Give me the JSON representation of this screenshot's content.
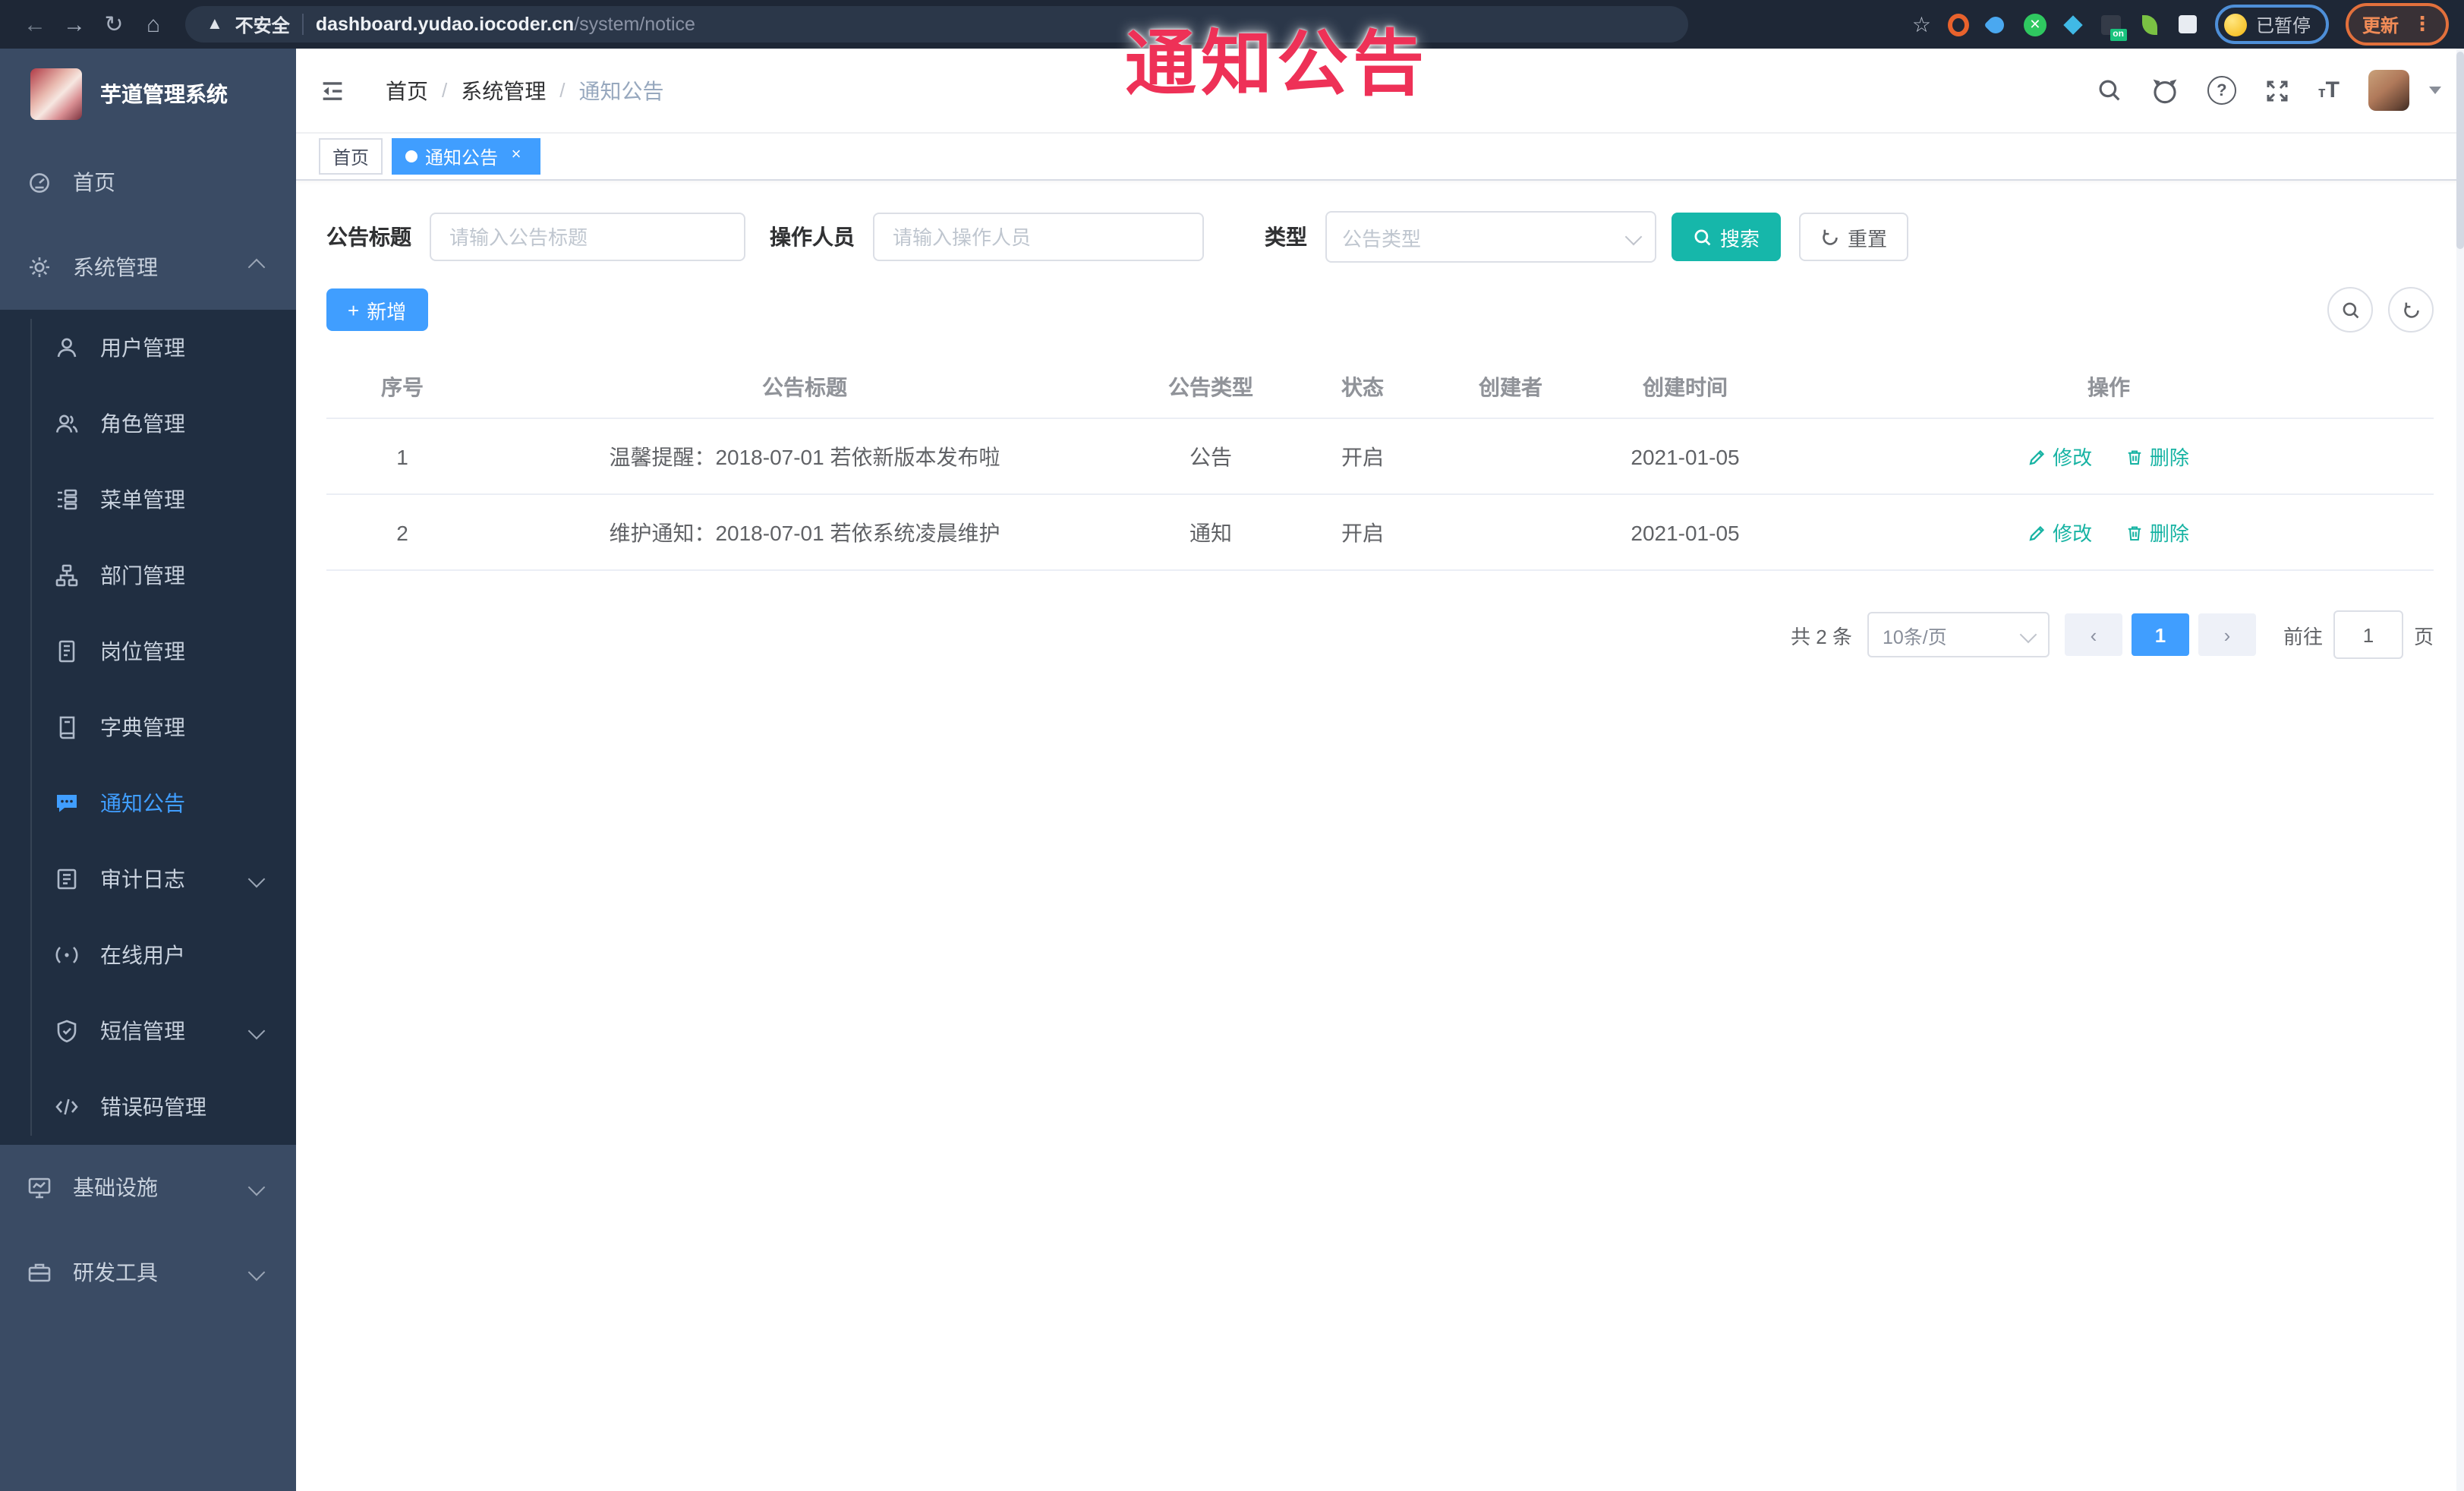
{
  "browser": {
    "security_label": "不安全",
    "url_host": "dashboard.yudao.iocoder.cn",
    "url_path": "/system/notice",
    "ext_on_badge": "on",
    "paused_label": "已暂停",
    "update_label": "更新"
  },
  "overlay": {
    "text": "通知公告"
  },
  "sidebar": {
    "title": "芋道管理系统",
    "items": [
      {
        "label": "首页"
      },
      {
        "label": "系统管理"
      },
      {
        "label": "用户管理"
      },
      {
        "label": "角色管理"
      },
      {
        "label": "菜单管理"
      },
      {
        "label": "部门管理"
      },
      {
        "label": "岗位管理"
      },
      {
        "label": "字典管理"
      },
      {
        "label": "通知公告"
      },
      {
        "label": "审计日志"
      },
      {
        "label": "在线用户"
      },
      {
        "label": "短信管理"
      },
      {
        "label": "错误码管理"
      },
      {
        "label": "基础设施"
      },
      {
        "label": "研发工具"
      }
    ]
  },
  "header": {
    "breadcrumb": [
      "首页",
      "系统管理",
      "通知公告"
    ],
    "separator": "/"
  },
  "tags": {
    "home": "首页",
    "active": "通知公告",
    "close": "×"
  },
  "filters": {
    "title_label": "公告标题",
    "title_placeholder": "请输入公告标题",
    "operator_label": "操作人员",
    "operator_placeholder": "请输入操作人员",
    "type_label": "类型",
    "type_placeholder": "公告类型",
    "search_label": "搜索",
    "reset_label": "重置"
  },
  "toolbar": {
    "add_label": "新增"
  },
  "table": {
    "headers": [
      "序号",
      "公告标题",
      "公告类型",
      "状态",
      "创建者",
      "创建时间",
      "操作"
    ],
    "rows": [
      {
        "no": "1",
        "title": "温馨提醒：2018-07-01 若依新版本发布啦",
        "type": "公告",
        "status": "开启",
        "creator": "",
        "created": "2021-01-05"
      },
      {
        "no": "2",
        "title": "维护通知：2018-07-01 若依系统凌晨维护",
        "type": "通知",
        "status": "开启",
        "creator": "",
        "created": "2021-01-05"
      }
    ],
    "edit_label": "修改",
    "delete_label": "删除"
  },
  "pagination": {
    "total_text": "共 2 条",
    "page_size": "10条/页",
    "current_page": "1",
    "goto_label": "前往",
    "goto_value": "1",
    "page_unit": "页"
  },
  "colors": {
    "primary": "#409eff",
    "teal_action": "#16b7aa",
    "sidebar_bg": "#3a4b64",
    "submenu_bg": "#202e41",
    "overlay_red": "#ee3157",
    "chrome_bg": "#1e2736"
  }
}
